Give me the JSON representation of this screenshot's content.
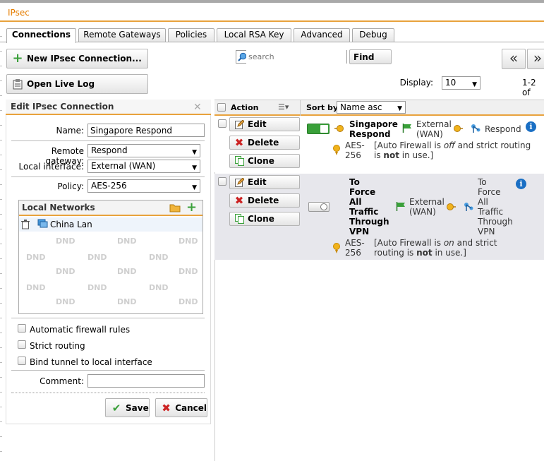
{
  "app": {
    "title": "IPsec"
  },
  "tabs": [
    {
      "label": "Connections",
      "active": true
    },
    {
      "label": "Remote Gateways"
    },
    {
      "label": "Policies"
    },
    {
      "label": "Local RSA Key"
    },
    {
      "label": "Advanced"
    },
    {
      "label": "Debug"
    }
  ],
  "toolbar": {
    "new_connection": "New IPsec Connection...",
    "open_log": "Open Live Log",
    "search_placeholder": "search",
    "find": "Find",
    "display_label": "Display:",
    "display_value": "10",
    "page_info": "1-2 of",
    "prev_icon": "«",
    "next_icon": "»"
  },
  "edit_form": {
    "title": "Edit IPsec Connection",
    "close_icon": "✕",
    "name_label": "Name:",
    "name_value": "Singapore Respond",
    "remote_gateway_label": "Remote gateway:",
    "remote_gateway_value": "Respond",
    "local_interface_label": "Local interface:",
    "local_interface_value": "External (WAN)",
    "policy_label": "Policy:",
    "policy_value": "AES-256",
    "local_networks_label": "Local Networks",
    "local_networks": [
      "China Lan"
    ],
    "dnd": "DND",
    "auto_fw_label": "Automatic firewall rules",
    "strict_routing_label": "Strict routing",
    "bind_tunnel_label": "Bind tunnel to local interface",
    "comment_label": "Comment:",
    "comment_value": "",
    "save": "Save",
    "cancel": "Cancel"
  },
  "grid": {
    "action_header": "Action",
    "sort_label": "Sort by:",
    "sort_value": "Name asc",
    "edit": "Edit",
    "delete": "Delete",
    "clone": "Clone",
    "rows": [
      {
        "name_line1": "Singapore",
        "name_line2": "Respond",
        "interface_line1": "External",
        "interface_line2": "(WAN)",
        "gateway": "Respond",
        "policy_line1": "AES-",
        "policy_line2": "256",
        "note_pre": "[Auto Firewall is ",
        "note_fw": "off",
        "note_mid": " and strict routing",
        "note_is": "is ",
        "note_not": "not",
        "note_end": " in use.]",
        "enabled": true
      },
      {
        "name_lines": [
          "To",
          "Force",
          "All",
          "Traffic",
          "Through",
          "VPN"
        ],
        "interface_line1": "External",
        "interface_line2": "(WAN)",
        "gateway_lines": [
          "To",
          "Force",
          "All",
          "Traffic",
          "Through",
          "VPN"
        ],
        "policy_line1": "AES-",
        "policy_line2": "256",
        "note_pre": "[Auto Firewall is ",
        "note_fw": "on",
        "note_mid": " and strict",
        "note_line2_pre": "routing is ",
        "note_not": "not",
        "note_end": " in use.]",
        "enabled": false
      }
    ]
  },
  "colors": {
    "accent": "#e8a23c",
    "title": "#e57d00",
    "toggle_on": "#3aa03a",
    "info": "#1a6fc4",
    "row_alt": "#e7e7ec"
  }
}
